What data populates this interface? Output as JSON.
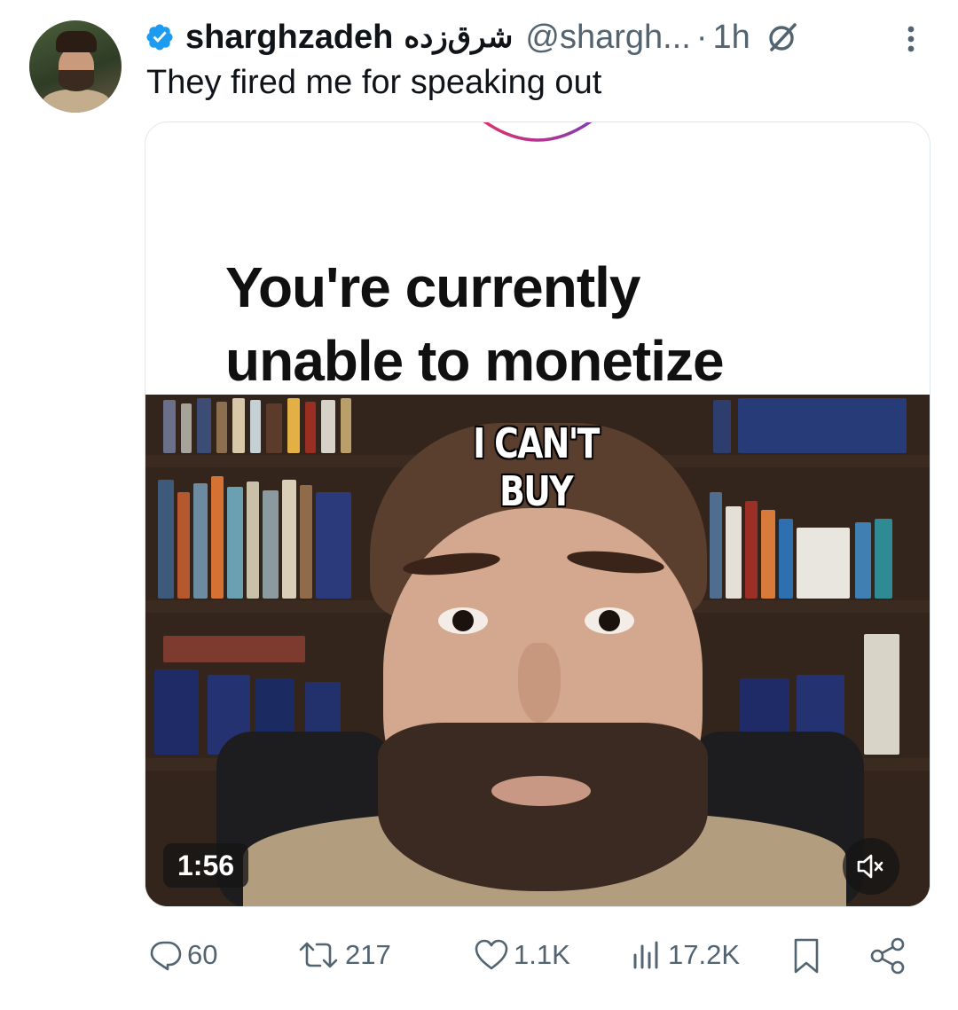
{
  "tweet": {
    "author_name": "sharghzadeh",
    "author_name_fa": "شرق‌زده",
    "handle": "@shargh...",
    "separator": "·",
    "time": "1h",
    "text": "They fired me for speaking out"
  },
  "card": {
    "headline_line1": "You're currently",
    "headline_line2": "unable to monetize",
    "video_caption": "I CAN'T BUY",
    "duration": "1:56"
  },
  "actions": {
    "replies": "60",
    "reposts": "217",
    "likes": "1.1K",
    "views": "17.2K"
  },
  "colors": {
    "verified": "#1d9bf0",
    "secondary_text": "#536471",
    "arc_start": "#e1306c",
    "arc_end": "#833ab4"
  }
}
